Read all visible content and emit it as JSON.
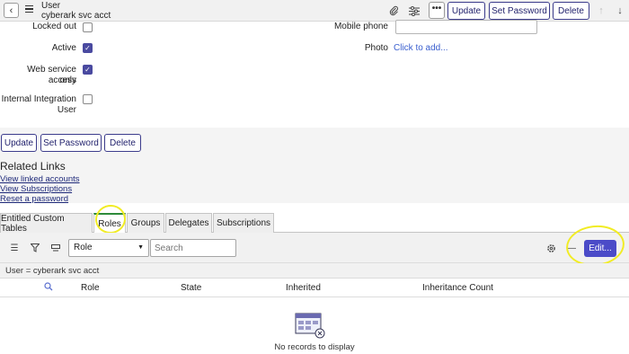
{
  "header": {
    "title": "User",
    "subtitle": "cyberark svc acct",
    "update_label": "Update",
    "set_password_label": "Set Password",
    "delete_label": "Delete",
    "more_label": "•••"
  },
  "form": {
    "locked_out_label": "Locked out",
    "active_label": "Active",
    "web_service_label_1": "Web service access",
    "web_service_label_2": "only",
    "internal_label_1": "Internal Integration",
    "internal_label_2": "User",
    "mobile_phone_label": "Mobile phone",
    "photo_label": "Photo",
    "photo_link": "Click to add...",
    "locked_out_checked": false,
    "active_checked": true,
    "web_service_checked": true,
    "internal_checked": false
  },
  "bottom_buttons": {
    "update_label": "Update",
    "set_password_label": "Set Password",
    "delete_label": "Delete"
  },
  "related_links": {
    "title": "Related Links",
    "items": [
      "View linked accounts",
      "View Subscriptions",
      "Reset a password"
    ]
  },
  "tabs": [
    {
      "label": "Entitled Custom Tables"
    },
    {
      "label": "Roles",
      "active": true
    },
    {
      "label": "Groups"
    },
    {
      "label": "Delegates"
    },
    {
      "label": "Subscriptions"
    }
  ],
  "list": {
    "select_value": "Role",
    "search_placeholder": "Search",
    "edit_label": "Edit...",
    "filter_text": "User = cyberark svc acct",
    "columns": [
      "Role",
      "State",
      "Inherited",
      "Inheritance Count"
    ],
    "empty_text": "No records to display"
  },
  "colors": {
    "accent": "#4b4bc8",
    "highlight": "#f1ec25",
    "active_tab": "#2e8b3a"
  }
}
